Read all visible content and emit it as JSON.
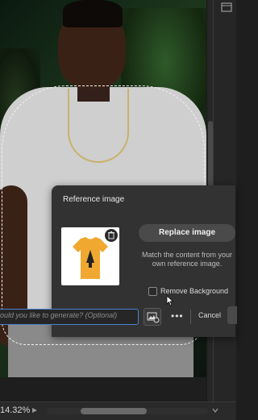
{
  "panel": {
    "title": "Reference image",
    "replace_label": "Replace image",
    "description": "Match the content from your own reference image.",
    "remove_bg_label": "Remove Background",
    "remove_bg_checked": false
  },
  "prompt_bar": {
    "placeholder": "ould you like to generate? (Optional)",
    "more_label": "•••",
    "cancel_label": "Cancel"
  },
  "status_bar": {
    "zoom": "14.32%"
  },
  "icons": {
    "trash": "trash-icon",
    "image_reference": "image-reference-icon",
    "corner": "window-icon"
  },
  "colors": {
    "panel_bg": "#323232",
    "accent_border": "#4b7fd1",
    "tshirt": "#f0a830"
  }
}
